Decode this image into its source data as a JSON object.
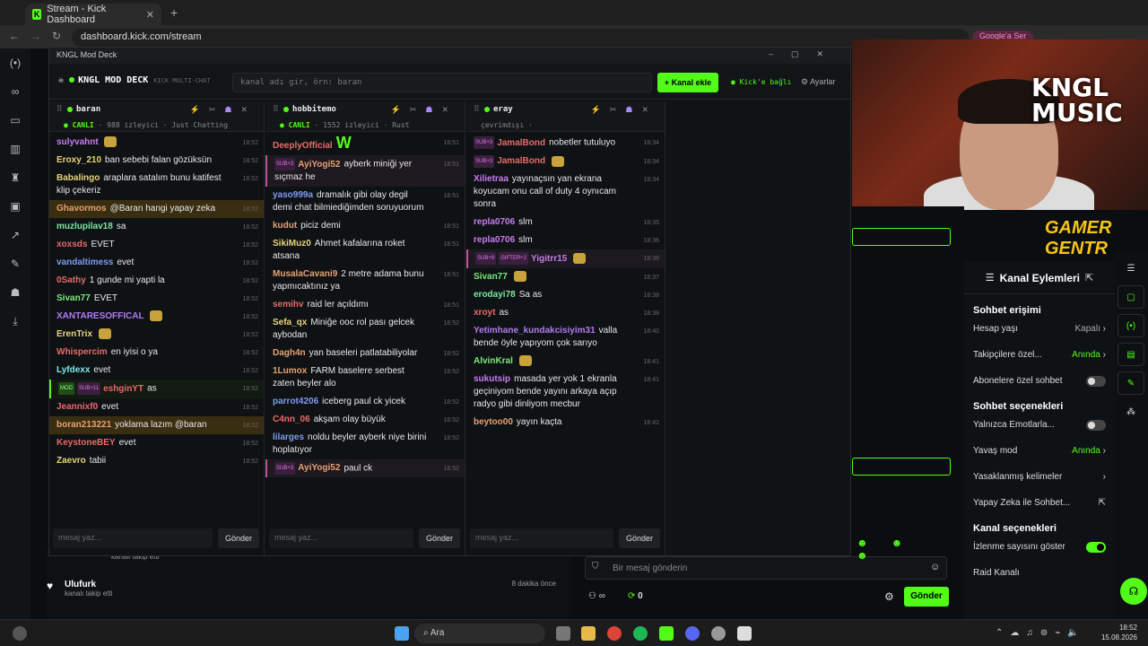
{
  "browser": {
    "tab_title": "Stream - Kick Dashboard",
    "url": "dashboard.kick.com/stream",
    "profile_badge": "Google'a Ser"
  },
  "deck": {
    "window_title": "KNGL Mod Deck",
    "brand": "KNGL MOD DECK",
    "brand_sub": "KICK MULTI-CHAT",
    "input_placeholder": "kanal adı gir, örn: baran",
    "add_label": "+ Kanal ekle",
    "linked_label": "● Kick'e bağlı",
    "settings_label": "⚙ Ayarlar",
    "send_label": "Gönder",
    "input_hint": "mesaj yaz..."
  },
  "columns": [
    {
      "name": "baran",
      "status": "● CANLI",
      "sub": "· 988 izleyici · Just Chatting",
      "messages": [
        {
          "u": "sulyvahnt",
          "c": "#c87cf0",
          "t": "",
          "time": "18:52",
          "emote": true
        },
        {
          "u": "Eroxy_210",
          "c": "#e8d47a",
          "t": "ban sebebi falan gözüksün",
          "time": "18:52"
        },
        {
          "u": "Babalingo",
          "c": "#e8d47a",
          "t": "araplara satalım bunu katifest klip çekeriz",
          "time": "18:52"
        },
        {
          "u": "Ghavormos",
          "c": "#e8a070",
          "t": "@Baran hangi yapay zeka",
          "time": "18:52",
          "hl": true
        },
        {
          "u": "muzlupilav18",
          "c": "#7ce8a0",
          "t": "sa",
          "time": "18:52"
        },
        {
          "u": "xoxsds",
          "c": "#e86a6a",
          "t": "EVET",
          "time": "18:52"
        },
        {
          "u": "vandaltimess",
          "c": "#7c9cf0",
          "t": "evet",
          "time": "18:52"
        },
        {
          "u": "0Sathy",
          "c": "#e86a6a",
          "t": "1 gunde mi yapti la",
          "time": "18:52"
        },
        {
          "u": "Sivan77",
          "c": "#7ce87c",
          "t": "EVET",
          "time": "18:52"
        },
        {
          "u": "XANTARESOFFICAL",
          "c": "#b07cf0",
          "t": "",
          "time": "18:52",
          "emote": true
        },
        {
          "u": "ErenTrix",
          "c": "#e8d47a",
          "t": "",
          "time": "18:52",
          "emote": true
        },
        {
          "u": "Whispercim",
          "c": "#e86a6a",
          "t": "en iyisi o ya",
          "time": "18:52"
        },
        {
          "u": "Lyfdexx",
          "c": "#7ce8e8",
          "t": "evet",
          "time": "18:52"
        },
        {
          "u": "eshginYT",
          "c": "#e86a6a",
          "t": "as",
          "time": "18:52",
          "badges": [
            "MOD",
            "SUB+11"
          ],
          "bl": true
        },
        {
          "u": "Jeannixf0",
          "c": "#e86a6a",
          "t": "evet",
          "time": "18:52"
        },
        {
          "u": "boran213221",
          "c": "#e8a070",
          "t": "yoklama lazım @baran",
          "time": "18:52",
          "hl": true
        },
        {
          "u": "KeystoneBEY",
          "c": "#e86a6a",
          "t": "evet",
          "time": "18:52"
        },
        {
          "u": "Zaevro",
          "c": "#e8d47a",
          "t": "tabii",
          "time": "18:52"
        }
      ]
    },
    {
      "name": "hobbitemo",
      "status": "● CANLI",
      "sub": "· 1552 izleyici · Rust",
      "messages": [
        {
          "u": "DeeplyOfficial",
          "c": "#e86a6a",
          "t": "W",
          "time": "18:51",
          "big": true
        },
        {
          "u": "AyiYogi52",
          "c": "#e8a070",
          "t": "ayberk miniği yer sıçmaz he",
          "time": "18:51",
          "badges": [
            "SUB+3"
          ],
          "hl2": true
        },
        {
          "u": "yaso999a",
          "c": "#7c9cf0",
          "t": "dramalık gibi olay degil demi chat bilmiediğimden soruyuorum",
          "time": "18:51"
        },
        {
          "u": "kudut",
          "c": "#e8a070",
          "t": "piciz demi",
          "time": "18:51"
        },
        {
          "u": "SikiMuz0",
          "c": "#e8d47a",
          "t": "Ahmet kafalarına roket atsana",
          "time": "18:51"
        },
        {
          "u": "MusalaCavani9",
          "c": "#e8a070",
          "t": "2 metre adama bunu yapmıcaktınız ya",
          "time": "18:51"
        },
        {
          "u": "semihv",
          "c": "#e86a6a",
          "t": "raid ler açıldımı",
          "time": "18:51"
        },
        {
          "u": "Sefa_qx",
          "c": "#e8d47a",
          "t": "Miniğe ooc rol pası gelcek aybodan",
          "time": "18:52"
        },
        {
          "u": "Dagh4n",
          "c": "#e8a070",
          "t": "yan baseleri patlatabiliyolar",
          "time": "18:52"
        },
        {
          "u": "1Lumox",
          "c": "#e8a070",
          "t": "FARM baselere serbest zaten beyler alo",
          "time": "18:52"
        },
        {
          "u": "parrot4206",
          "c": "#7c9cf0",
          "t": "iceberg paul ck yicek",
          "time": "18:52"
        },
        {
          "u": "C4nn_06",
          "c": "#e86a6a",
          "t": "akşam olay büyük",
          "time": "18:52"
        },
        {
          "u": "lilarges",
          "c": "#7c9cf0",
          "t": "noldu beyler ayberk niye birini hoplatıyor",
          "time": "18:52"
        },
        {
          "u": "AyiYogi52",
          "c": "#e8a070",
          "t": "paul ck",
          "time": "18:52",
          "badges": [
            "SUB+3"
          ],
          "hl2": true
        }
      ]
    },
    {
      "name": "eray",
      "status": "",
      "sub": "çevrimdışı ·",
      "messages": [
        {
          "u": "JamalBond",
          "c": "#e86a6a",
          "t": "nobetler tutuluyo",
          "time": "18:34",
          "badges": [
            "SUB+3"
          ]
        },
        {
          "u": "JamalBond",
          "c": "#e86a6a",
          "t": "",
          "time": "18:34",
          "badges": [
            "SUB+3"
          ],
          "emote": true
        },
        {
          "u": "Xilietraa",
          "c": "#c87cf0",
          "t": "yayınaçsın yan ekrana koyucam onu call of duty 4 oynıcam sonra",
          "time": "18:34"
        },
        {
          "u": "repla0706",
          "c": "#c87cf0",
          "t": "slm",
          "time": "18:35"
        },
        {
          "u": "repla0706",
          "c": "#c87cf0",
          "t": "slm",
          "time": "18:36"
        },
        {
          "u": "Yigitrr15",
          "c": "#c87cf0",
          "t": "",
          "time": "18:36",
          "badges": [
            "SUB+9",
            "GIFTER+2"
          ],
          "emote": true,
          "hl2": true
        },
        {
          "u": "Sivan77",
          "c": "#7ce87c",
          "t": "",
          "time": "18:37",
          "emote": true
        },
        {
          "u": "erodayi78",
          "c": "#7ce8a0",
          "t": "Sa as",
          "time": "18:38"
        },
        {
          "u": "xroyt",
          "c": "#e86a6a",
          "t": "as",
          "time": "18:38"
        },
        {
          "u": "Yetimhane_kundakcisiyim31",
          "c": "#b07cf0",
          "t": "valla bende öyle yapıyom çok sarıyo",
          "time": "18:40"
        },
        {
          "u": "AlvinKral",
          "c": "#7ce87c",
          "t": "",
          "time": "18:41",
          "emote": true
        },
        {
          "u": "sukutsip",
          "c": "#c87cf0",
          "t": "masada yer yok 1 ekranla geçiniyom bende yayını arkaya açıp radyo gibi dinliyom mecbur",
          "time": "18:41"
        },
        {
          "u": "beytoo00",
          "c": "#e8a070",
          "t": "yayın kaçta",
          "time": "18:42"
        }
      ]
    }
  ],
  "bg_page": {
    "follows": [
      {
        "name": "",
        "action": "kanalı takip etti",
        "time": ""
      },
      {
        "name": "Ulufurk",
        "action": "kanalı takip etti",
        "time": "8 dakika önce"
      }
    ],
    "chat_placeholder": "Bir mesaj gönderin",
    "send_label": "Gönder",
    "viewer_count": "0"
  },
  "kanal": {
    "title": "Kanal Eylemleri",
    "sec1": "Sohbet erişimi",
    "rows1": [
      {
        "label": "Hesap yaşı",
        "value": "Kapalı",
        "type": "arrow",
        "accent": false
      },
      {
        "label": "Takipçilere özel...",
        "value": "Anında",
        "type": "arrow",
        "accent": true
      },
      {
        "label": "Abonelere özel sohbet",
        "value": "",
        "type": "toggle",
        "on": false
      }
    ],
    "sec2": "Sohbet seçenekleri",
    "rows2": [
      {
        "label": "Yalnızca Emotlarla...",
        "value": "",
        "type": "toggle",
        "on": false
      },
      {
        "label": "Yavaş mod",
        "value": "Anında",
        "type": "arrow",
        "accent": true
      },
      {
        "label": "Yasaklanmış kelimeler",
        "value": "",
        "type": "arrow"
      },
      {
        "label": "Yapay Zeka ile Sohbet...",
        "value": "",
        "type": "ext"
      }
    ],
    "sec3": "Kanal seçenekleri",
    "rows3": [
      {
        "label": "İzlenme sayısını göster",
        "value": "",
        "type": "toggle",
        "on": true
      },
      {
        "label": "Raid Kanalı",
        "value": "",
        "type": "none"
      }
    ]
  },
  "overlay": {
    "kngl": "KNGL MUSIC",
    "gamer": "GAMER GENTR"
  },
  "taskbar": {
    "search": "Ara",
    "time": "18:52",
    "date": "15.08.2026"
  },
  "colors": {
    "accent": "#53fc18"
  }
}
